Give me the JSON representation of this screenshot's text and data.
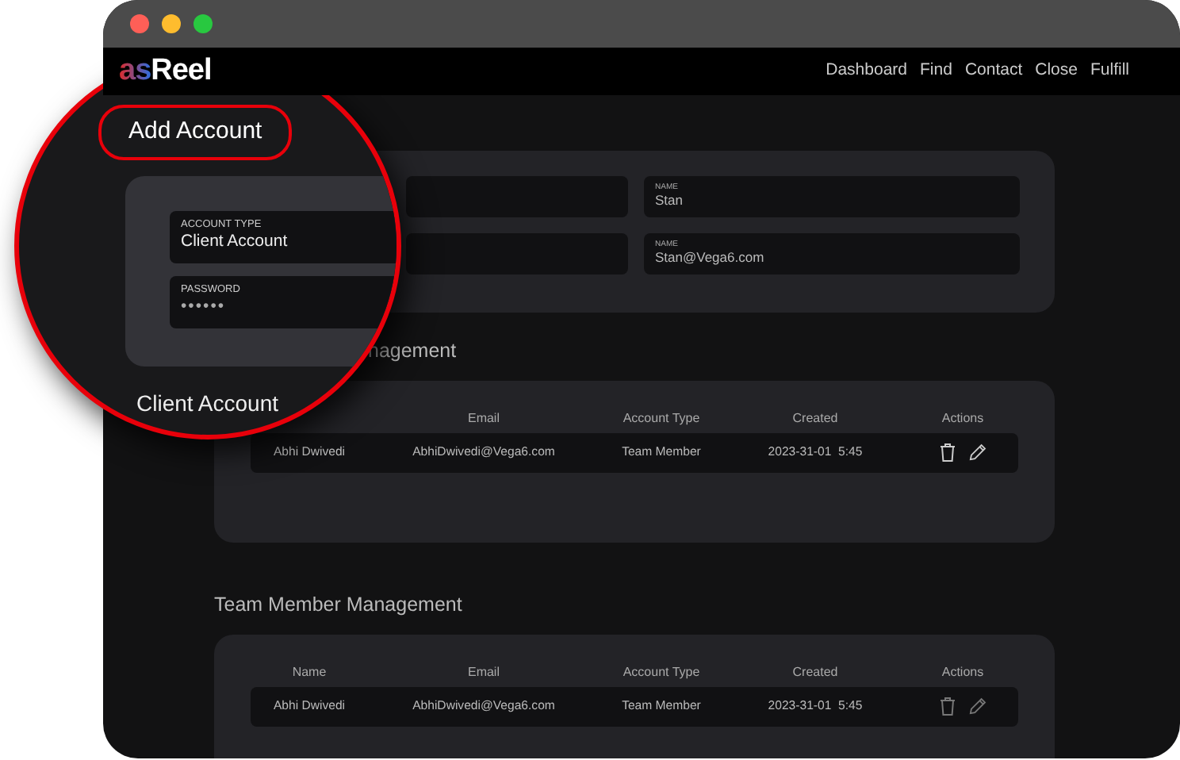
{
  "navbar": {
    "logo": {
      "accent": "as",
      "text": "Reel"
    },
    "links": [
      "Dashboard",
      "Find",
      "Contact",
      "Close",
      "Fulfill"
    ]
  },
  "add_account_form": {
    "fields": [
      {
        "label": "NAME",
        "value": "Stan"
      },
      {
        "label": "NAME",
        "value": "Stan@Vega6.com"
      }
    ]
  },
  "client_account_management": {
    "heading": "nagement",
    "columns": [
      "Email",
      "Account Type",
      "Created",
      "Actions"
    ],
    "rows": [
      {
        "name": "Abhi Dwivedi",
        "email": "AbhiDwivedi@Vega6.com",
        "account_type": "Team Member",
        "created": "2023-31-01  5:45"
      }
    ]
  },
  "team_member_management": {
    "heading": "Team Member Management",
    "columns": [
      "Name",
      "Email",
      "Account Type",
      "Created",
      "Actions"
    ],
    "rows": [
      {
        "name": "Abhi Dwivedi",
        "email": "AbhiDwivedi@Vega6.com",
        "account_type": "Team Member",
        "created": "2023-31-01  5:45"
      }
    ]
  },
  "magnifier": {
    "heading": "Add Account",
    "fields": [
      {
        "label": "ACCOUNT TYPE",
        "value": "Client Account",
        "kind": "text"
      },
      {
        "label": "PASSWORD",
        "value": "••••••",
        "kind": "password"
      }
    ],
    "section_heading": "Client Account"
  }
}
